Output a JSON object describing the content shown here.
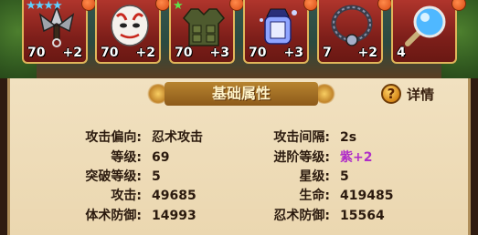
{
  "equipment": [
    {
      "stars": 4,
      "star_color": "#5fd0ff",
      "level": "70",
      "plus": "+2",
      "icon": "kunai-icon"
    },
    {
      "stars": 0,
      "star_color": "",
      "level": "70",
      "plus": "+2",
      "icon": "mask-icon"
    },
    {
      "stars": 1,
      "star_color": "#5ee24a",
      "level": "70",
      "plus": "+3",
      "icon": "vest-icon"
    },
    {
      "stars": 0,
      "star_color": "",
      "level": "70",
      "plus": "+3",
      "icon": "charm-icon"
    },
    {
      "stars": 0,
      "star_color": "",
      "level": "7",
      "plus": "+2",
      "icon": "necklace-icon"
    },
    {
      "stars": 0,
      "star_color": "",
      "level": "4",
      "plus": "",
      "icon": "magnifier-orb-icon"
    }
  ],
  "panel": {
    "title": "基础属性",
    "detail_label": "详情",
    "detail_icon_glyph": "?"
  },
  "stats": {
    "left": [
      {
        "label": "攻击偏向:",
        "value": "忍术攻击"
      },
      {
        "label": "等级:",
        "value": "69"
      },
      {
        "label": "突破等级:",
        "value": "5"
      },
      {
        "label": "攻击:",
        "value": "49685"
      },
      {
        "label": "体术防御:",
        "value": "14993"
      }
    ],
    "right": [
      {
        "label": "攻击间隔:",
        "value": "2s"
      },
      {
        "label": "进阶等级:",
        "value": "紫+2",
        "color": "#b02ec8"
      },
      {
        "label": "星级:",
        "value": "5"
      },
      {
        "label": "生命:",
        "value": "419485"
      },
      {
        "label": "忍术防御:",
        "value": "15564"
      }
    ]
  }
}
